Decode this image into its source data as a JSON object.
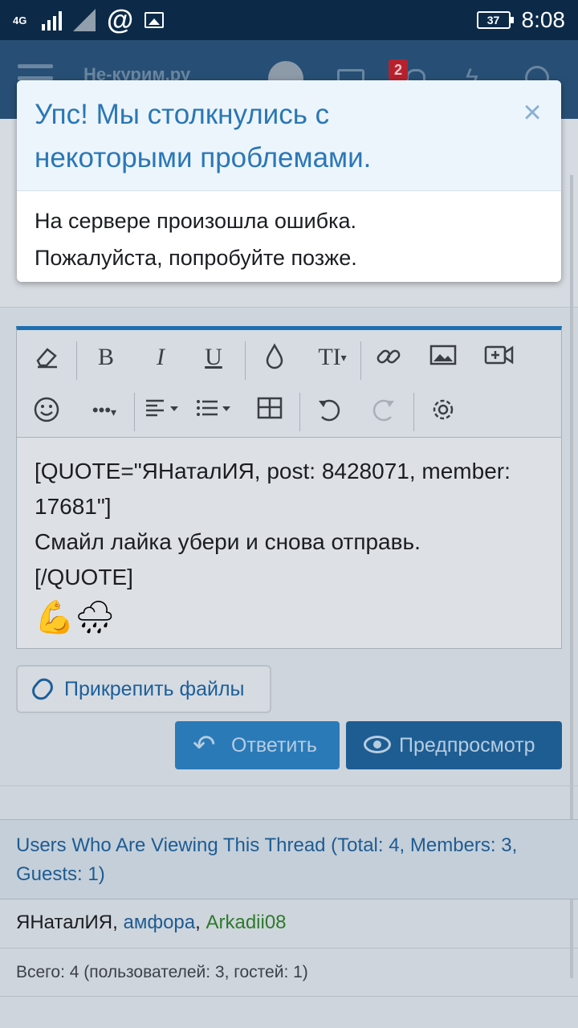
{
  "status_bar": {
    "network": "4G",
    "battery": "37",
    "time": "8:08",
    "at_symbol": "@"
  },
  "app_header": {
    "logo": "Не-курим.ру",
    "alerts_badge": "2"
  },
  "error_modal": {
    "title": "Упс! Мы столкнулись с некоторыми проблемами.",
    "close_symbol": "×",
    "message_line1": "На сервере произошла ошибка.",
    "message_line2": "Пожалуйста, попробуйте позже."
  },
  "editor": {
    "toolbar_icons": [
      "eraser-icon",
      "bold-icon",
      "italic-icon",
      "underline-icon",
      "color-drop-icon",
      "text-size-icon",
      "link-icon",
      "image-icon",
      "video-icon",
      "emoji-icon",
      "more-icon",
      "align-icon",
      "list-icon",
      "table-icon",
      "undo-icon",
      "redo-icon",
      "settings-icon"
    ],
    "bold_glyph": "B",
    "italic_glyph": "I",
    "underline_glyph": "U",
    "text_size_glyph": "TI",
    "more_glyph": "•••",
    "content_line1": "[QUOTE=\"ЯНаталИЯ, post: 8428071, member: 17681\"]",
    "content_line2": "Смайл лайка убери и снова отправь.",
    "content_line3": "[/QUOTE]",
    "emojis": "💪🌧"
  },
  "buttons": {
    "attach_label": "Прикрепить файлы",
    "reply_label": "Ответить",
    "preview_label": "Предпросмотр"
  },
  "viewers": {
    "title": "Users Who Are Viewing This Thread (Total: 4, Members: 3, Guests: 1)",
    "user1": "ЯНаталИЯ",
    "sep": ", ",
    "user2": "амфора",
    "user3": "Arkadii08",
    "total": "Всего: 4 (пользователей: 3, гостей: 1)"
  },
  "colors": {
    "status_bar": "#0c2a48",
    "accent_blue": "#1e6fb0",
    "modal_title": "#2a77b7",
    "green_user": "#2d7a2d"
  }
}
